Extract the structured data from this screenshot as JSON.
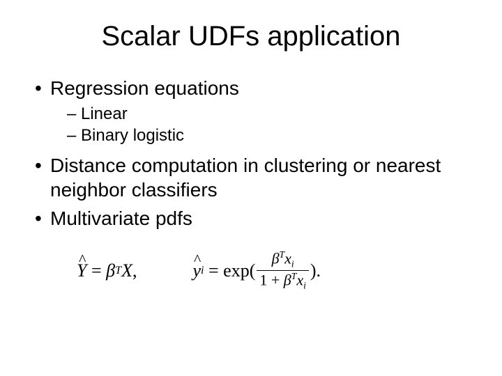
{
  "title": "Scalar UDFs application",
  "bullets": {
    "b1": "Regression equations",
    "b1_sub1": "Linear",
    "b1_sub2": "Binary logistic",
    "b2": "Distance computation in clustering or nearest neighbor classifiers",
    "b3": "Multivariate pdfs"
  },
  "formulas": {
    "f1_plain": "Ŷ = βᵀX,",
    "f2_plain": "ŷᵢ = exp(βᵀxᵢ / (1 + βᵀxᵢ))."
  }
}
